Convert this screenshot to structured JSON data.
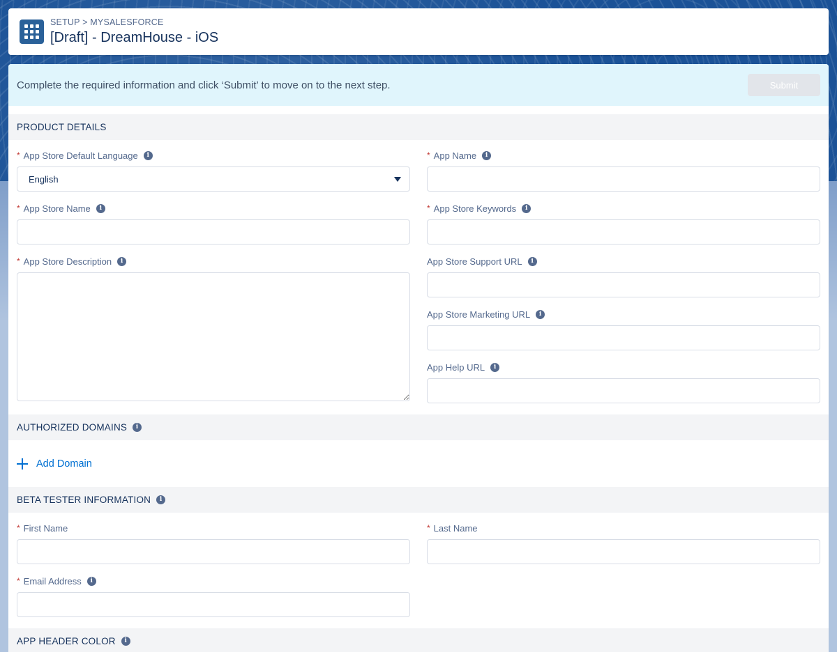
{
  "header": {
    "breadcrumb": "SETUP > MYSALESFORCE",
    "title": "[Draft] - DreamHouse - iOS",
    "launcher_icon": "app-launcher-grid-icon"
  },
  "banner": {
    "message": "Complete the required information and click ‘Submit’ to move on to the next step.",
    "submit_label": "Submit"
  },
  "product_details": {
    "heading": "PRODUCT DETAILS",
    "fields": {
      "default_language": {
        "label": "App Store Default Language",
        "value": "English",
        "required": true
      },
      "app_name": {
        "label": "App Name",
        "value": "",
        "required": true
      },
      "store_name": {
        "label": "App Store Name",
        "value": "",
        "required": true
      },
      "keywords": {
        "label": "App Store Keywords",
        "value": "",
        "required": true
      },
      "description": {
        "label": "App Store Description",
        "value": "",
        "required": true
      },
      "support_url": {
        "label": "App Store Support URL",
        "value": "",
        "required": false
      },
      "marketing_url": {
        "label": "App Store Marketing URL",
        "value": "",
        "required": false
      },
      "help_url": {
        "label": "App Help URL",
        "value": "",
        "required": false
      }
    }
  },
  "authorized_domains": {
    "heading": "AUTHORIZED DOMAINS",
    "add_label": "Add Domain"
  },
  "beta_tester": {
    "heading": "BETA TESTER INFORMATION",
    "fields": {
      "first_name": {
        "label": "First Name",
        "value": "",
        "required": true
      },
      "last_name": {
        "label": "Last Name",
        "value": "",
        "required": true
      },
      "email": {
        "label": "Email Address",
        "value": "",
        "required": true
      }
    }
  },
  "app_header_color": {
    "heading": "APP HEADER COLOR"
  },
  "colors": {
    "brand": "#2a6199",
    "link": "#0070d2",
    "required": "#c23934",
    "banner_bg": "#e0f5fc"
  },
  "required_marker": "*",
  "info_glyph": "i"
}
